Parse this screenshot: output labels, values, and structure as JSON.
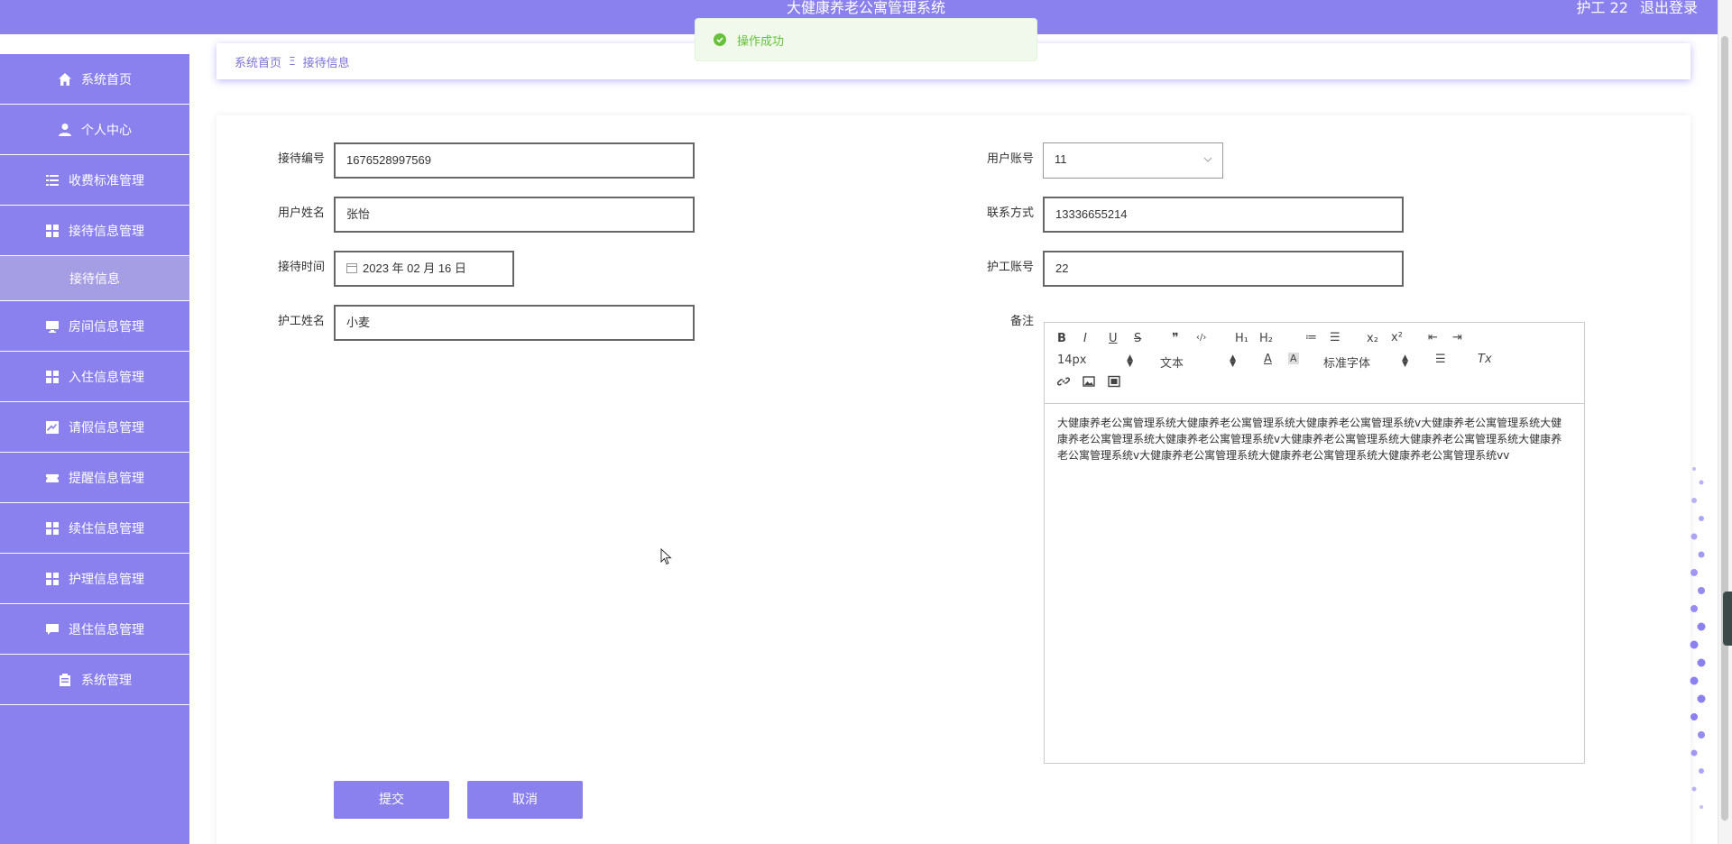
{
  "header": {
    "title": "大健康养老公寓管理系统",
    "user_label": "护工 22",
    "logout_label": "退出登录"
  },
  "toast": {
    "message": "操作成功"
  },
  "sidebar": {
    "items": [
      {
        "label": "系统首页",
        "icon": "home-icon"
      },
      {
        "label": "个人中心",
        "icon": "user-icon"
      },
      {
        "label": "收费标准管理",
        "icon": "list-icon"
      },
      {
        "label": "接待信息管理",
        "icon": "grid-icon"
      },
      {
        "label": "房间信息管理",
        "icon": "monitor-icon"
      },
      {
        "label": "入住信息管理",
        "icon": "grid-icon"
      },
      {
        "label": "请假信息管理",
        "icon": "chart-icon"
      },
      {
        "label": "提醒信息管理",
        "icon": "ticket-icon"
      },
      {
        "label": "续住信息管理",
        "icon": "grid-icon"
      },
      {
        "label": "护理信息管理",
        "icon": "grid-icon"
      },
      {
        "label": "退住信息管理",
        "icon": "chat-icon"
      },
      {
        "label": "系统管理",
        "icon": "clipboard-icon"
      }
    ],
    "sub_item": "接待信息"
  },
  "breadcrumb": {
    "home": "系统首页",
    "separator": "Ξ",
    "current": "接待信息"
  },
  "form": {
    "reception_no": {
      "label": "接待编号",
      "value": "1676528997569"
    },
    "user_name": {
      "label": "用户姓名",
      "value": "张怡"
    },
    "reception_time": {
      "label": "接待时间",
      "value": "2023 年 02 月 16 日"
    },
    "nurse_name": {
      "label": "护工姓名",
      "value": "小麦"
    },
    "user_account": {
      "label": "用户账号",
      "value": "11"
    },
    "contact": {
      "label": "联系方式",
      "value": "13336655214"
    },
    "nurse_account": {
      "label": "护工账号",
      "value": "22"
    },
    "remark": {
      "label": "备注",
      "content": "大健康养老公寓管理系统大健康养老公寓管理系统大健康养老公寓管理系统v大健康养老公寓管理系统大健康养老公寓管理系统大健康养老公寓管理系统v大健康养老公寓管理系统大健康养老公寓管理系统大健康养老公寓管理系统v大健康养老公寓管理系统大健康养老公寓管理系统大健康养老公寓管理系统vv"
    }
  },
  "editor_toolbar": {
    "bold": "B",
    "italic": "I",
    "underline": "U",
    "strike": "S",
    "quote": "❞",
    "code": "‹/›",
    "h1": "H₁",
    "h2": "H₂",
    "ol": "≔",
    "ul": "☰",
    "sub": "x₂",
    "sup": "x²",
    "outdent": "⇤",
    "indent": "⇥",
    "size": "14px",
    "header": "文本",
    "color": "A",
    "bg": "A",
    "font": "标准字体",
    "align": "☰",
    "clean": "Tx",
    "link": "link-icon",
    "image": "image-icon",
    "video": "video-icon"
  },
  "buttons": {
    "submit": "提交",
    "cancel": "取消"
  },
  "colors": {
    "primary": "#8a80ee",
    "sub_active": "#a69ee4",
    "success": "#67c23a"
  }
}
